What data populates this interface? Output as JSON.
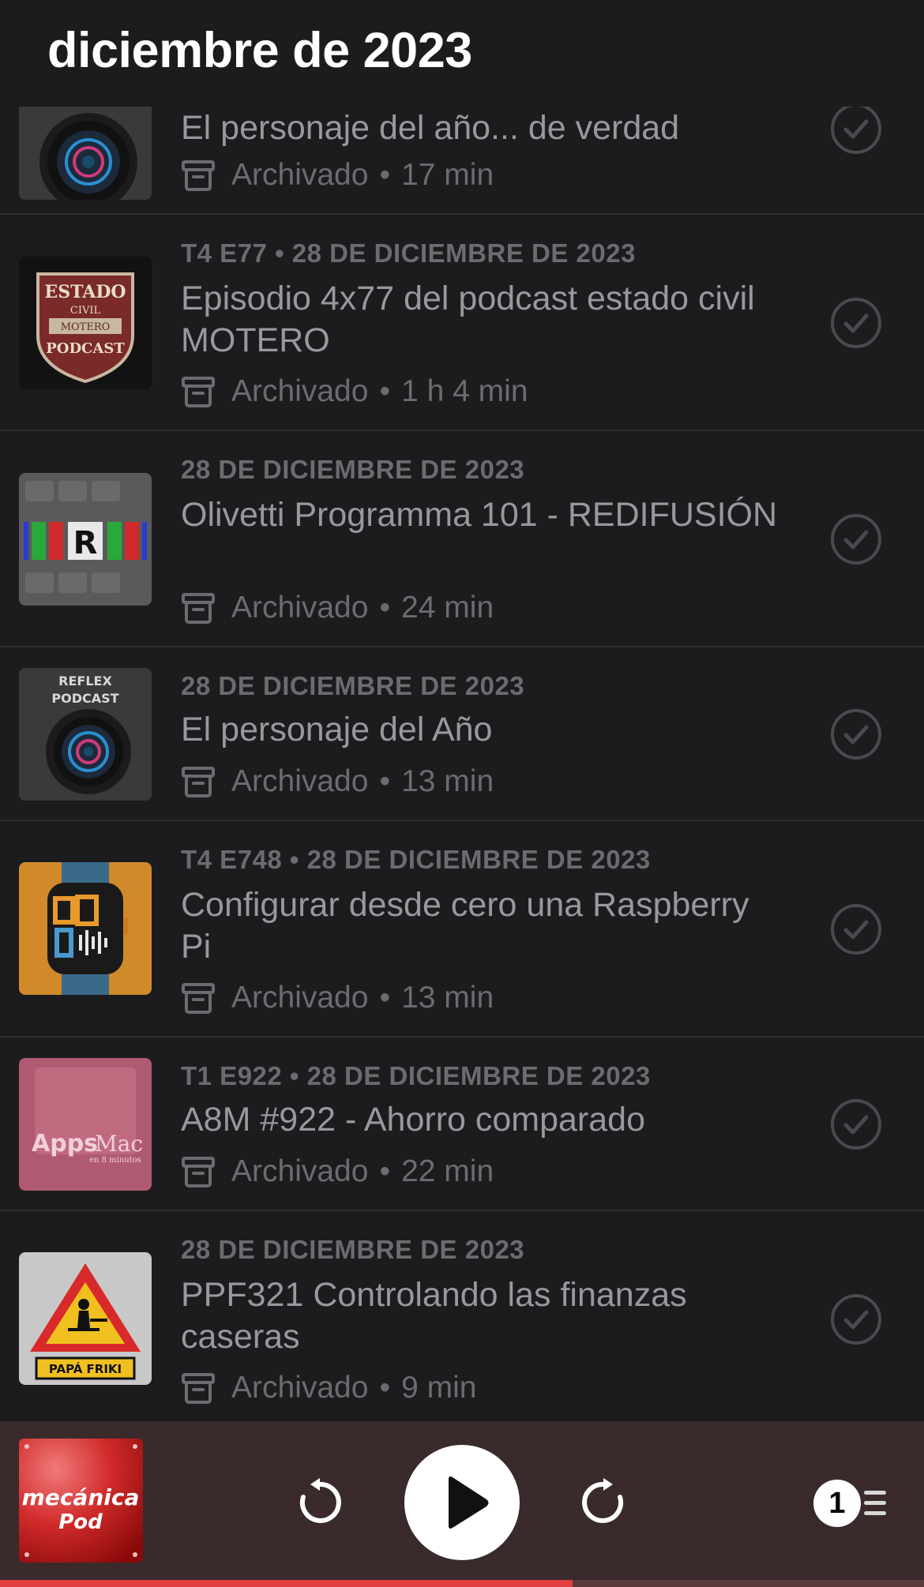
{
  "header": {
    "title": "diciembre de 2023"
  },
  "episodes": [
    {
      "meta": "",
      "title": "El personaje del año... de verdad",
      "status": "Archivado",
      "duration": "17 min",
      "artwork": "reflex-podcast"
    },
    {
      "meta": "T4 E77 • 28 DE DICIEMBRE DE 2023",
      "title": "Episodio 4x77 del podcast estado civil MOTERO",
      "status": "Archivado",
      "duration": "1 h 4 min",
      "artwork": "estado-civil-motero"
    },
    {
      "meta": "28 DE DICIEMBRE DE 2023",
      "title": "Olivetti Programma 101 - REDIFUSIÓN",
      "status": "Archivado",
      "duration": "24 min",
      "artwork": "redifusion"
    },
    {
      "meta": "28 DE DICIEMBRE DE 2023",
      "title": "El personaje del Año",
      "status": "Archivado",
      "duration": "13 min",
      "artwork": "reflex-podcast"
    },
    {
      "meta": "T4 E748 • 28 DE DICIEMBRE DE 2023",
      "title": "Configurar desde cero una Raspberry Pi",
      "status": "Archivado",
      "duration": "13 min",
      "artwork": "der-watch"
    },
    {
      "meta": "T1 E922 • 28 DE DICIEMBRE DE 2023",
      "title": "A8M #922 - Ahorro comparado",
      "status": "Archivado",
      "duration": "22 min",
      "artwork": "appsmac"
    },
    {
      "meta": "28 DE DICIEMBRE DE 2023",
      "title": "PPF321 Controlando las finanzas caseras",
      "status": "Archivado",
      "duration": "9 min",
      "artwork": "papa-friki"
    }
  ],
  "artwork_text": {
    "reflex": [
      "REFLEX",
      "PODCAST"
    ],
    "estado": [
      "ESTADO",
      "CIVIL",
      "MOTERO",
      "PODCAST"
    ],
    "redifusion": "R",
    "appsmac": [
      "Apps",
      "Mac",
      "en 8 minutos"
    ],
    "papafriki": "PAPÁ FRIKI",
    "mecanica": [
      "mecánica",
      "Pod"
    ]
  },
  "player": {
    "queue_count": "1",
    "progress": 0.62,
    "accent_color": "#e0403f"
  },
  "icons": {
    "archive": "archive-box-icon",
    "played": "checkmark-circle-icon",
    "skip_back": "skip-back-icon",
    "play": "play-icon",
    "skip_forward": "skip-forward-icon",
    "queue": "queue-list-icon"
  }
}
